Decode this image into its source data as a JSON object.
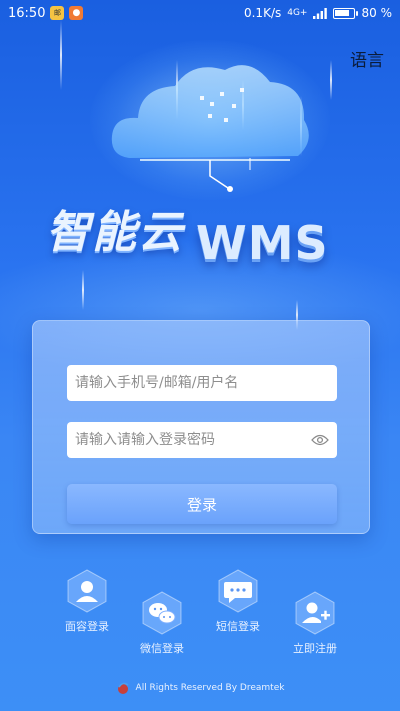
{
  "status_bar": {
    "time": "16:50",
    "badge_text": "邮",
    "network_speed": "0.1K/s",
    "signal_label": "4G+",
    "battery_percent": "80",
    "battery_symbol": "%",
    "battery_level": 0.8
  },
  "header": {
    "language_label": "语言"
  },
  "brand": {
    "name_cn": "智能云",
    "name_en": "WMS"
  },
  "login": {
    "username_placeholder": "请输入手机号/邮箱/用户名",
    "password_placeholder": "请输入请输入登录密码",
    "submit_label": "登录"
  },
  "quick_actions": [
    {
      "label": "面容登录",
      "icon": "face-id-icon"
    },
    {
      "label": "微信登录",
      "icon": "wechat-icon"
    },
    {
      "label": "短信登录",
      "icon": "sms-icon"
    },
    {
      "label": "立即注册",
      "icon": "add-user-icon"
    }
  ],
  "footer": {
    "copyright": "All Rights Reserved By Dreamtek"
  },
  "colors": {
    "primary": "#2a74f0",
    "button": "#6aa2fb",
    "text_dark": "#0b1c3a"
  }
}
